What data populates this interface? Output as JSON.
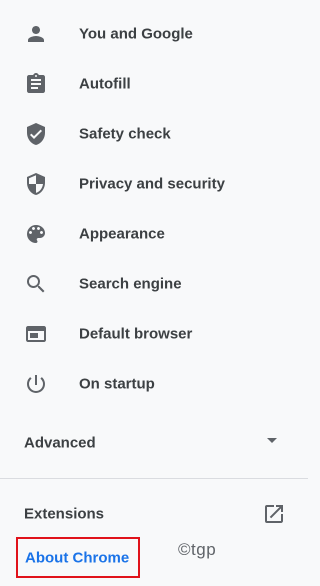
{
  "menu": {
    "items": [
      {
        "label": "You and Google",
        "icon": "person-icon"
      },
      {
        "label": "Autofill",
        "icon": "clipboard-icon"
      },
      {
        "label": "Safety check",
        "icon": "shield-check-icon"
      },
      {
        "label": "Privacy and security",
        "icon": "shield-half-icon"
      },
      {
        "label": "Appearance",
        "icon": "palette-icon"
      },
      {
        "label": "Search engine",
        "icon": "search-icon"
      },
      {
        "label": "Default browser",
        "icon": "browser-window-icon"
      },
      {
        "label": "On startup",
        "icon": "power-icon"
      }
    ],
    "advanced_label": "Advanced",
    "extensions_label": "Extensions",
    "about_label": "About Chrome"
  },
  "watermark": "©tgp",
  "colors": {
    "background": "#f8f9fa",
    "text": "#3c4043",
    "icon": "#5f6368",
    "link": "#1a73e8",
    "highlight_box": "#e0121a"
  }
}
